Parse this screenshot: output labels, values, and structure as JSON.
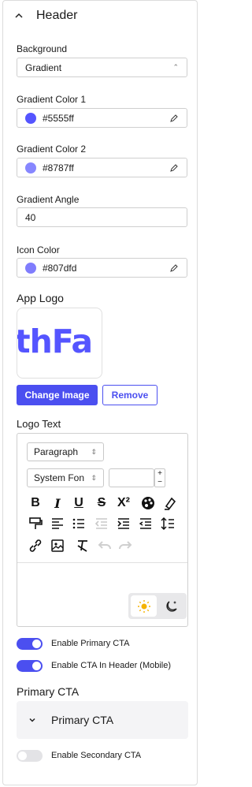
{
  "section": {
    "title": "Header"
  },
  "background": {
    "label": "Background",
    "value": "Gradient"
  },
  "gradient_color_1": {
    "label": "Gradient Color 1",
    "value": "#5555ff",
    "color": "#5555ff"
  },
  "gradient_color_2": {
    "label": "Gradient Color 2",
    "value": "#8787ff",
    "color": "#8787ff"
  },
  "gradient_angle": {
    "label": "Gradient Angle",
    "value": "40"
  },
  "icon_color": {
    "label": "Icon Color",
    "value": "#807dfd",
    "color": "#807dfd"
  },
  "app_logo": {
    "label": "App Logo",
    "preview_text": "thFa",
    "change_label": "Change Image",
    "remove_label": "Remove"
  },
  "logo_text": {
    "label": "Logo Text",
    "block_format": "Paragraph",
    "font_family": "System Fon",
    "font_size": "",
    "toolbar_icons": [
      "bold-icon",
      "italic-icon",
      "underline-icon",
      "strikethrough-icon",
      "superscript-icon",
      "text-color-icon",
      "highlight-icon",
      "format-painter-icon",
      "align-left-icon",
      "bullet-list-icon",
      "outdent-icon",
      "indent-icon",
      "rtl-icon",
      "line-height-icon",
      "link-icon",
      "image-icon",
      "clear-format-icon",
      "undo-icon",
      "redo-icon"
    ],
    "theme_options": [
      "light-mode-icon",
      "dark-mode-icon"
    ]
  },
  "toggles": {
    "primary_cta": {
      "label": "Enable Primary CTA",
      "on": true
    },
    "cta_in_header": {
      "label": "Enable CTA In Header (Mobile)",
      "on": true
    },
    "secondary_cta": {
      "label": "Enable Secondary CTA",
      "on": false
    }
  },
  "primary_cta_section": {
    "label": "Primary CTA",
    "accordion_title": "Primary CTA"
  },
  "colors": {
    "accent": "#4b4ff0",
    "toggle_off": "#e3e3e6"
  }
}
